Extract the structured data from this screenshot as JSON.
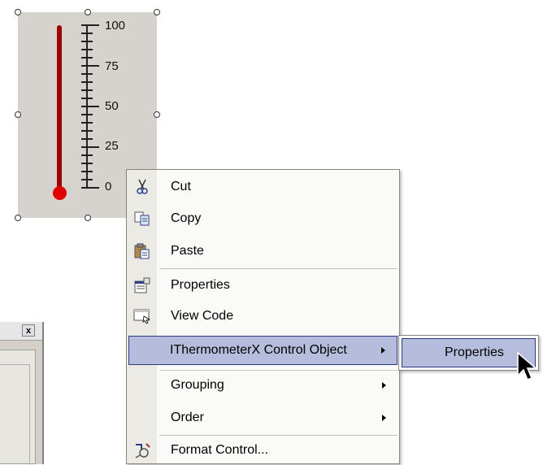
{
  "thermometer": {
    "scale_labels": [
      "100",
      "75",
      "50",
      "25",
      "0"
    ],
    "value": 100,
    "range": [
      0,
      100
    ],
    "colors": {
      "face": "#d6d3ce",
      "tube": "#9d0000",
      "bulb": "#e00000"
    }
  },
  "background_dialog": {
    "close_label": "x"
  },
  "context_menu": {
    "items": [
      {
        "label": "Cut",
        "icon": "scissors-icon"
      },
      {
        "label": "Copy",
        "icon": "copy-icon"
      },
      {
        "label": "Paste",
        "icon": "paste-icon"
      },
      {
        "label": "Properties",
        "icon": "properties-icon"
      },
      {
        "label": "View Code",
        "icon": "view-code-icon"
      },
      {
        "label": "IThermometerX Control Object",
        "icon": "",
        "has_submenu": true,
        "highlighted": true
      },
      {
        "label": "Grouping",
        "icon": "",
        "has_submenu": true
      },
      {
        "label": "Order",
        "icon": "",
        "has_submenu": true
      },
      {
        "label": "Format Control...",
        "icon": "format-control-icon"
      }
    ]
  },
  "submenu": {
    "items": [
      {
        "label": "Properties",
        "highlighted": true
      }
    ]
  },
  "colors": {
    "highlight_fill": "#b6bddc",
    "highlight_border": "#2c3a86"
  }
}
